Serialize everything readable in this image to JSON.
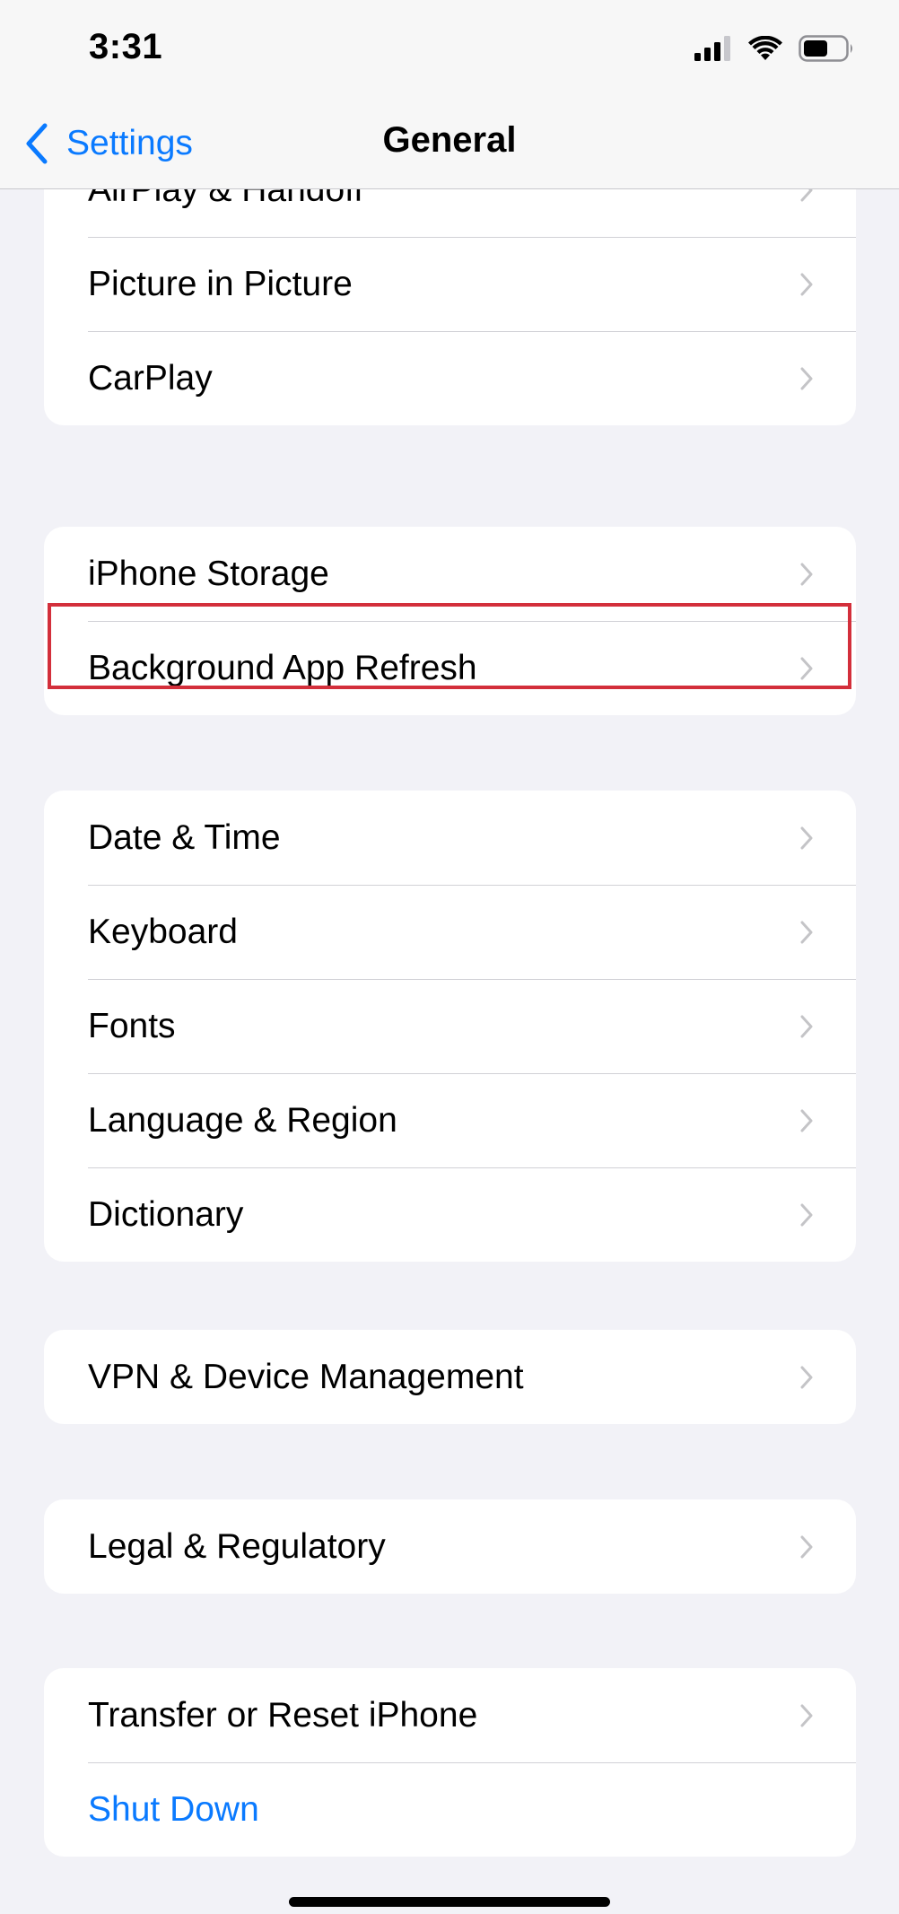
{
  "status_bar": {
    "time": "3:31",
    "icons": [
      "cellular-signal-icon",
      "wifi-icon",
      "battery-icon"
    ]
  },
  "nav": {
    "back_label": "Settings",
    "title": "General"
  },
  "groups": [
    {
      "rows": [
        {
          "label": "AirPlay & Handoff"
        },
        {
          "label": "Picture in Picture"
        },
        {
          "label": "CarPlay"
        }
      ]
    },
    {
      "rows": [
        {
          "label": "iPhone Storage"
        },
        {
          "label": "Background App Refresh"
        }
      ]
    },
    {
      "rows": [
        {
          "label": "Date & Time"
        },
        {
          "label": "Keyboard"
        },
        {
          "label": "Fonts"
        },
        {
          "label": "Language & Region"
        },
        {
          "label": "Dictionary"
        }
      ]
    },
    {
      "rows": [
        {
          "label": "VPN & Device Management"
        }
      ]
    },
    {
      "rows": [
        {
          "label": "Legal & Regulatory"
        }
      ]
    },
    {
      "rows": [
        {
          "label": "Transfer or Reset iPhone"
        },
        {
          "label": "Shut Down"
        }
      ]
    }
  ],
  "colors": {
    "accent": "#0a7aff",
    "highlight": "#d32f3b",
    "background": "#f2f2f7"
  }
}
